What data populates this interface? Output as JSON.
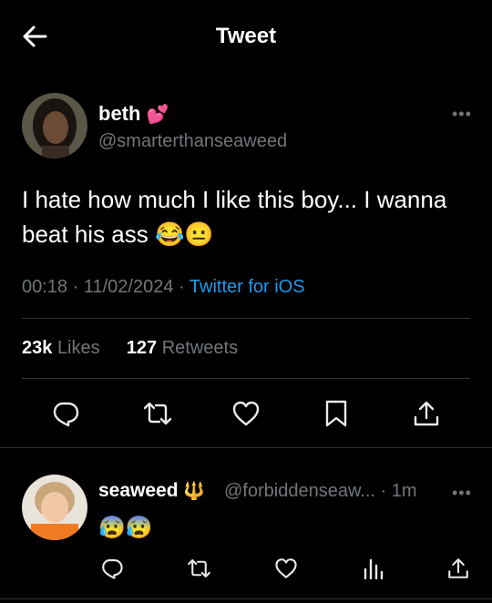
{
  "header": {
    "title": "Tweet"
  },
  "tweet": {
    "display_name": "beth",
    "name_emoji": "💕",
    "handle": "@smarterthanseaweed",
    "text_line1": "I hate how much I like this boy... I wanna",
    "text_line2": "beat his ass",
    "text_emojis": "😂😐",
    "time": "00:18",
    "date": "11/02/2024",
    "source": "Twitter for iOS",
    "likes_count": "23k",
    "likes_label": "Likes",
    "retweets_count": "127",
    "retweets_label": "Retweets",
    "more": "•••"
  },
  "reply": {
    "display_name": "seaweed",
    "name_emoji": "🔱",
    "handle": "@forbiddenseaw...",
    "separator": "·",
    "time": "1m",
    "text": "😰😰",
    "more": "•••"
  },
  "colors": {
    "background": "#000000",
    "text": "#e7e9ea",
    "muted": "#71767b",
    "accent": "#1d9bf0",
    "divider": "#2f3336"
  },
  "icons": {
    "back": "arrow-left-icon",
    "reply": "reply-icon",
    "retweet": "retweet-icon",
    "like": "heart-icon",
    "bookmark": "bookmark-icon",
    "share": "share-icon",
    "views": "analytics-icon"
  }
}
